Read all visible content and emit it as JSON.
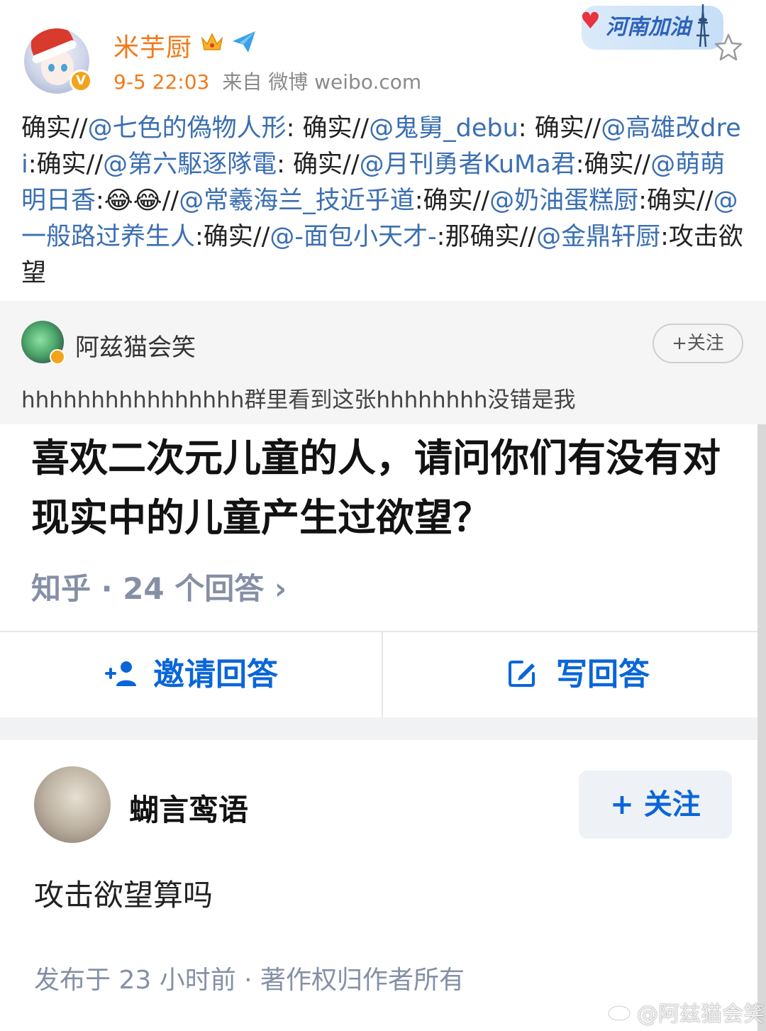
{
  "post": {
    "username": "米芋厨",
    "time": "9-5 22:03",
    "source": "来自 微博 weibo.com",
    "badge_text": "河南加油",
    "verify_mark": "V",
    "repost": [
      {
        "t": "text",
        "v": "确实//"
      },
      {
        "t": "mention",
        "v": "@七色的偽物人形"
      },
      {
        "t": "text",
        "v": ": 确实//"
      },
      {
        "t": "mention",
        "v": "@鬼舅_debu"
      },
      {
        "t": "text",
        "v": ": 确实//"
      },
      {
        "t": "mention",
        "v": "@高雄改drei"
      },
      {
        "t": "text",
        "v": ":确实//"
      },
      {
        "t": "mention",
        "v": "@第六駆逐隊電"
      },
      {
        "t": "text",
        "v": ": 确实//"
      },
      {
        "t": "mention",
        "v": "@月刊勇者KuMa君"
      },
      {
        "t": "text",
        "v": ":确实//"
      },
      {
        "t": "mention",
        "v": "@萌萌明日香"
      },
      {
        "t": "text",
        "v": ":😂😂//"
      },
      {
        "t": "mention",
        "v": "@常羲海兰_技近乎道"
      },
      {
        "t": "text",
        "v": ":确实//"
      },
      {
        "t": "mention",
        "v": "@奶油蛋糕厨"
      },
      {
        "t": "text",
        "v": ":确实//"
      },
      {
        "t": "mention",
        "v": "@一般路过养生人"
      },
      {
        "t": "text",
        "v": ":确实//"
      },
      {
        "t": "mention",
        "v": "@-面包小天才-"
      },
      {
        "t": "text",
        "v": ":那确实//"
      },
      {
        "t": "mention",
        "v": "@金鼎轩厨"
      },
      {
        "t": "text",
        "v": ":攻击欲望"
      }
    ]
  },
  "quoted": {
    "name": "阿兹猫会笑",
    "follow_label": "+关注",
    "text": "hhhhhhhhhhhhhhhh群里看到这张hhhhhhhh没错是我"
  },
  "zhihu": {
    "question": "喜欢二次元儿童的人，请问你们有没有对现实中的儿童产生过欲望？",
    "meta": "知乎 · 24 个回答 ›",
    "invite_label": "邀请回答",
    "write_label": "写回答",
    "author": "蝴言鸾语",
    "follow_label": "+ 关注",
    "answer": "攻击欲望算吗",
    "footer": "发布于 23 小时前 · 著作权归作者所有"
  },
  "watermark": "@阿兹猫会笑",
  "colors": {
    "username": "#f07a1b",
    "mention": "#3b6fb1",
    "zhihu_blue": "#0a66d8",
    "meta_gray": "#8590a6"
  }
}
